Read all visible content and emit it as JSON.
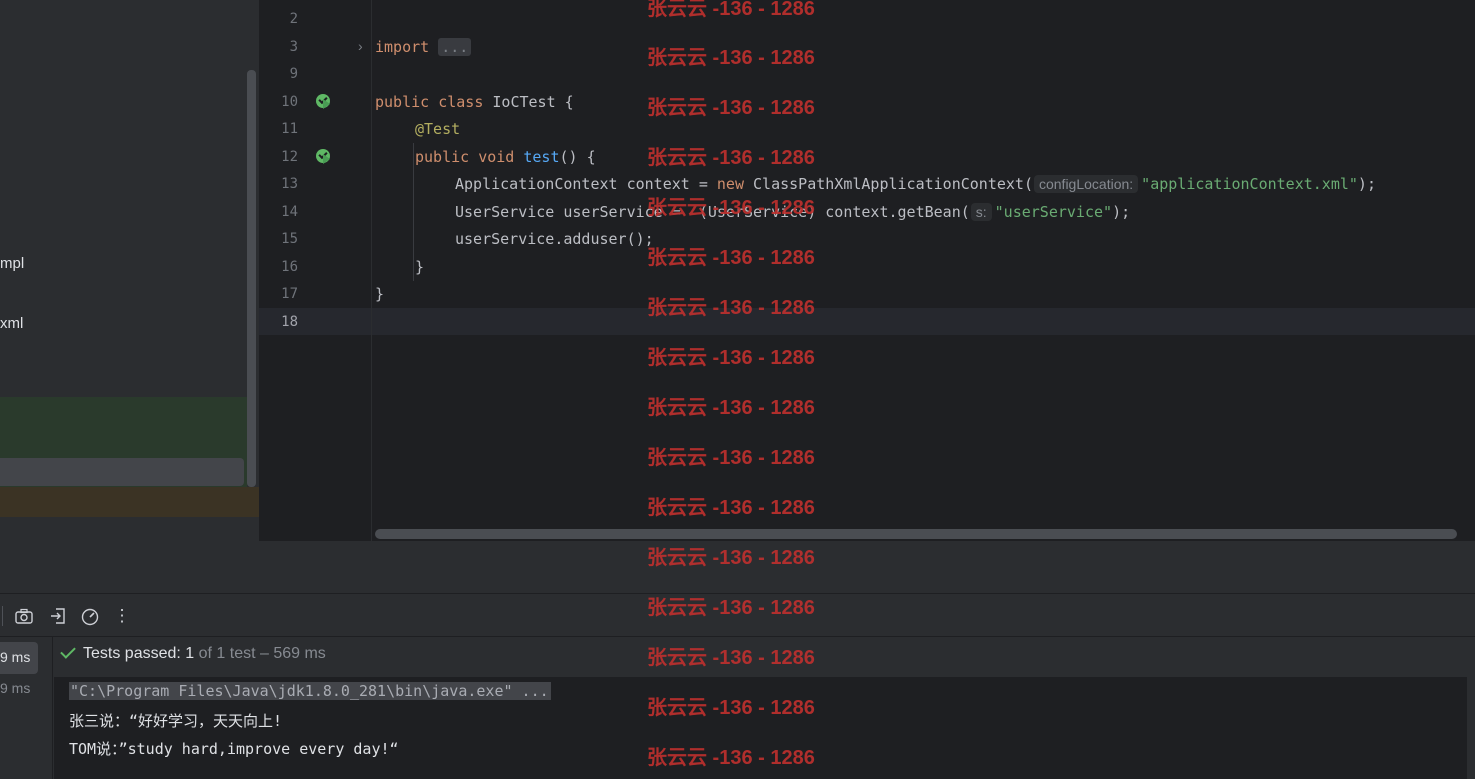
{
  "project_panel": {
    "items": [
      {
        "label": "mpl"
      },
      {
        "label": "xml"
      }
    ]
  },
  "editor": {
    "line_numbers": [
      "2",
      "3",
      "9",
      "10",
      "11",
      "12",
      "13",
      "14",
      "15",
      "16",
      "17",
      "18"
    ],
    "fold_placeholder": "...",
    "code": {
      "l3_import": "import",
      "l10_public": "public",
      "l10_class": "class",
      "l10_rest": " IoCTest {",
      "l11_annotation": "@Test",
      "l12_public": "public",
      "l12_void": "void",
      "l12_method": "test",
      "l12_rest": "() {",
      "l13_a": "ApplicationContext context = ",
      "l13_new": "new",
      "l13_b": " ClassPathXmlApplicationContext(",
      "l13_hint": "configLocation:",
      "l13_str": "\"applicationContext.xml\"",
      "l13_end": ");",
      "l14_a": "UserService userService =  (UserService) context.getBean(",
      "l14_hint": "s:",
      "l14_str": "\"userService\"",
      "l14_end": ");",
      "l15": "userService.adduser();",
      "l16": "}",
      "l17": "}"
    }
  },
  "run_panel": {
    "toolbar_icons": [
      "camera-icon",
      "import-icon",
      "gauge-icon",
      "more-vertical-icon"
    ],
    "tree_times": [
      "9 ms",
      "9 ms"
    ],
    "status": {
      "passed": "Tests passed: 1",
      "rest": "of 1 test – 569 ms"
    },
    "console": [
      "\"C:\\Program Files\\Java\\jdk1.8.0_281\\bin\\java.exe\" ...",
      "张三说：“好好学习，天天向上!",
      "TOM说：”study hard,improve every day!“"
    ]
  },
  "watermark": {
    "text": "张云云 -136 - 1286"
  },
  "colors": {
    "editor_bg": "#1e1f22",
    "panel_bg": "#2b2d30",
    "keyword": "#cf8e6d",
    "string": "#6aab73",
    "function": "#56a8f5",
    "annotation": "#b3ae60",
    "success": "#5fb865",
    "watermark": "#c0302e"
  }
}
